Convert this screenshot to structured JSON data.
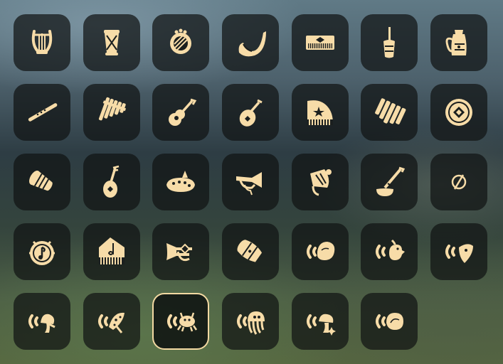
{
  "inventory": {
    "slots": [
      {
        "icon": "lyre-icon",
        "selected": false
      },
      {
        "icon": "drum-icon",
        "selected": false
      },
      {
        "icon": "round-harp-icon",
        "selected": false
      },
      {
        "icon": "horn-icon",
        "selected": false
      },
      {
        "icon": "keyboard-icon",
        "selected": false
      },
      {
        "icon": "rattle-icon",
        "selected": false
      },
      {
        "icon": "bell-pot-icon",
        "selected": false
      },
      {
        "icon": "flute-icon",
        "selected": false
      },
      {
        "icon": "panpipe-icon",
        "selected": false
      },
      {
        "icon": "guitar-icon",
        "selected": false
      },
      {
        "icon": "lute-icon",
        "selected": false
      },
      {
        "icon": "grand-piano-icon",
        "selected": false
      },
      {
        "icon": "xylophone-icon",
        "selected": false
      },
      {
        "icon": "disc-drum-icon",
        "selected": false
      },
      {
        "icon": "hand-drum-icon",
        "selected": false
      },
      {
        "icon": "pipa-icon",
        "selected": false
      },
      {
        "icon": "ocarina-icon",
        "selected": false
      },
      {
        "icon": "bugle-icon",
        "selected": false
      },
      {
        "icon": "horn-bell-icon",
        "selected": false
      },
      {
        "icon": "shovel-instrument-icon",
        "selected": false
      },
      {
        "icon": "empty-slot-icon",
        "selected": false
      },
      {
        "icon": "music-drum-icon",
        "selected": false
      },
      {
        "icon": "piano-flag-icon",
        "selected": false
      },
      {
        "icon": "trumpet-icon",
        "selected": false
      },
      {
        "icon": "barrel-drum-icon",
        "selected": false
      },
      {
        "icon": "sound-shell-icon",
        "selected": false
      },
      {
        "icon": "sound-bird-icon",
        "selected": false
      },
      {
        "icon": "sound-pick-icon",
        "selected": false
      },
      {
        "icon": "sound-mushroom-icon",
        "selected": false
      },
      {
        "icon": "sound-spotted-mushroom-icon",
        "selected": false
      },
      {
        "icon": "sound-crab-icon",
        "selected": true
      },
      {
        "icon": "sound-jellyfish-icon",
        "selected": false
      },
      {
        "icon": "sound-sparkle-mushroom-icon",
        "selected": false
      },
      {
        "icon": "sound-round-shell-icon",
        "selected": false
      }
    ]
  },
  "colors": {
    "icon": "#f7dca8",
    "slot_bg": "#101414",
    "selected_border": "#f2d9a2"
  }
}
